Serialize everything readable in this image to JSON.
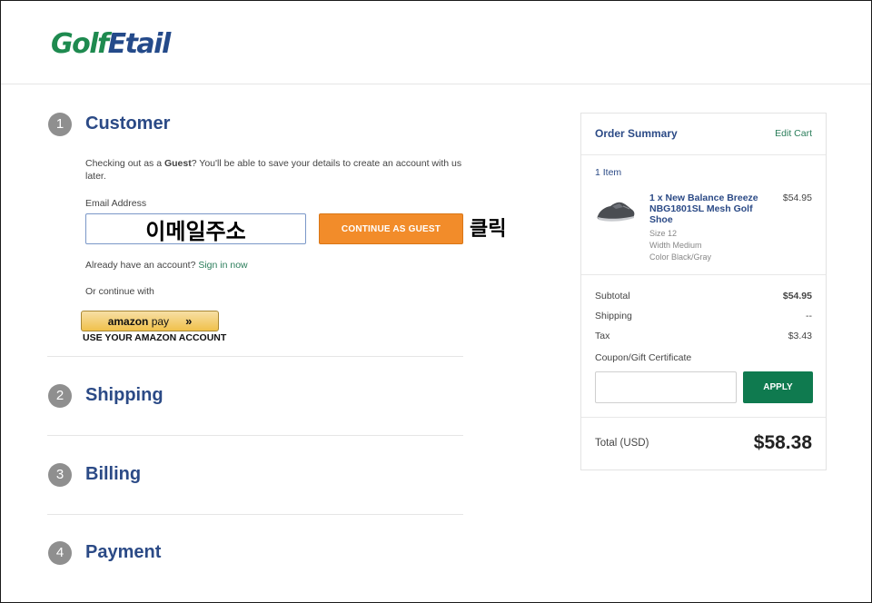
{
  "header": {
    "logo_part1": "Golf",
    "logo_part2": "Etail"
  },
  "steps": [
    {
      "number": "1",
      "title": "Customer"
    },
    {
      "number": "2",
      "title": "Shipping"
    },
    {
      "number": "3",
      "title": "Billing"
    },
    {
      "number": "4",
      "title": "Payment"
    }
  ],
  "customer": {
    "guest_text_before": "Checking out as a ",
    "guest_text_bold": "Guest",
    "guest_text_after": "? You'll be able to save your details to create an account with us",
    "guest_text_line2": "later.",
    "email_label": "Email Address",
    "email_annotation": "이메일주소",
    "continue_button": "CONTINUE AS GUEST",
    "click_annotation": "클릭",
    "have_account_text": "Already have an account? ",
    "sign_in_link": "Sign in now",
    "or_continue": "Or continue with",
    "amazon_logo_text": "amazon",
    "amazon_pay_text": " pay",
    "amazon_chevron": "»",
    "amazon_caption": "USE YOUR AMAZON ACCOUNT"
  },
  "summary": {
    "title": "Order Summary",
    "edit_cart": "Edit Cart",
    "item_count": "1 Item",
    "item": {
      "name_line1": "1 x New Balance Breeze",
      "name_line2": "NBG1801SL Mesh Golf",
      "name_line3": "Shoe",
      "price": "$54.95",
      "size": "Size 12",
      "width": "Width Medium",
      "color": "Color Black/Gray"
    },
    "subtotal_label": "Subtotal",
    "subtotal_value": "$54.95",
    "shipping_label": "Shipping",
    "shipping_value": "--",
    "tax_label": "Tax",
    "tax_value": "$3.43",
    "coupon_label": "Coupon/Gift Certificate",
    "coupon_placeholder": "",
    "apply_button": "APPLY",
    "total_label": "Total (USD)",
    "total_value": "$58.38"
  },
  "colors": {
    "brand_green": "#1e8a4f",
    "brand_blue": "#244a8a",
    "step_title": "#2b4a86",
    "guest_button": "#f28c2a",
    "apply_button": "#0f7a4f"
  }
}
